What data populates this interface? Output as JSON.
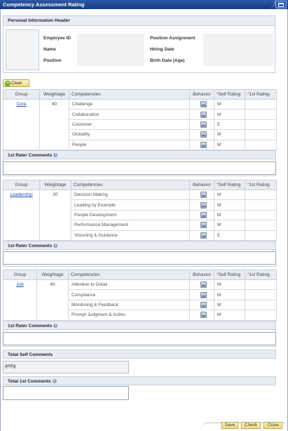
{
  "window": {
    "title": "Competency Assessment Rating"
  },
  "personal_info": {
    "header": "Personal Information Header",
    "labels": {
      "employee_id": "Employee ID",
      "name": "Name",
      "position": "Position",
      "position_assignment": "Position Assignment",
      "hiring_date": "Hiring Date",
      "birth_date": "Birth Date (Age)"
    }
  },
  "toolbar": {
    "clear_label": "Clear"
  },
  "table_headers": {
    "group": "Group",
    "weightage": "Weightage",
    "competencies": "Competencies",
    "behavior": "Behavior",
    "self_rating": "Self Rating",
    "first_rating": "1st Rating",
    "required_marker": "*"
  },
  "groups": [
    {
      "name": "Core",
      "weightage": "40",
      "rows": [
        {
          "competency": "Challenge",
          "self_rating": "M"
        },
        {
          "competency": "Collaboration",
          "self_rating": "M"
        },
        {
          "competency": "Customer",
          "self_rating": "E"
        },
        {
          "competency": "Globality",
          "self_rating": "M"
        },
        {
          "competency": "People",
          "self_rating": "M"
        }
      ]
    },
    {
      "name": "Leadership",
      "weightage": "20",
      "rows": [
        {
          "competency": "Decision Making",
          "self_rating": "M"
        },
        {
          "competency": "Leading by Example",
          "self_rating": "M"
        },
        {
          "competency": "People Development",
          "self_rating": "M"
        },
        {
          "competency": "Performance Management",
          "self_rating": "M"
        },
        {
          "competency": "Visioning & Guidance",
          "self_rating": "E"
        }
      ]
    },
    {
      "name": "Job",
      "weightage": "40",
      "rows": [
        {
          "competency": "Attention to Detail",
          "self_rating": "M"
        },
        {
          "competency": "Compliance",
          "self_rating": "M"
        },
        {
          "competency": "Monitoring & Feedback",
          "self_rating": "M"
        },
        {
          "competency": "Prompt Judgment & Action",
          "self_rating": "M"
        }
      ]
    }
  ],
  "comments": {
    "rater_label": "1st Rater Comments",
    "total_self_label": "Total Self Comments",
    "total_self_value": "ghjfgj",
    "total_first_label": "Total 1st Comments"
  },
  "footer": {
    "save": "Save",
    "check": "Check",
    "close": "Close"
  }
}
